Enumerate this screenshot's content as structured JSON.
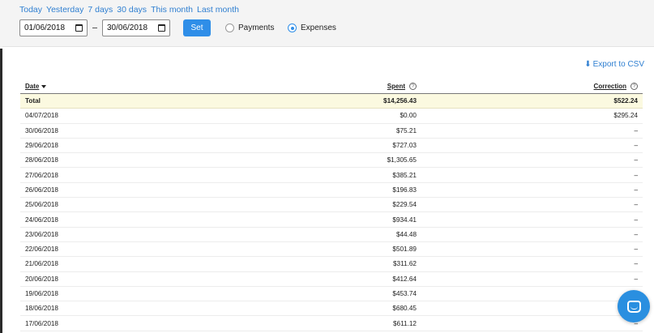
{
  "filters": {
    "quick_links": [
      "Today",
      "Yesterday",
      "7 days",
      "30 days",
      "This month",
      "Last month"
    ],
    "date_from": "01/06/2018",
    "date_to": "30/06/2018",
    "set_label": "Set",
    "radio_payments": "Payments",
    "radio_expenses": "Expenses",
    "selected": "Expenses"
  },
  "export_label": "Export to CSV",
  "table": {
    "columns": [
      "Date",
      "Spent",
      "Correction"
    ],
    "sort_column": "Date",
    "total": {
      "label": "Total",
      "spent": "$14,256.43",
      "correction": "$522.24"
    },
    "rows": [
      {
        "date": "04/07/2018",
        "spent": "$0.00",
        "correction": "$295.24"
      },
      {
        "date": "30/06/2018",
        "spent": "$75.21",
        "correction": "–"
      },
      {
        "date": "29/06/2018",
        "spent": "$727.03",
        "correction": "–"
      },
      {
        "date": "28/06/2018",
        "spent": "$1,305.65",
        "correction": "–"
      },
      {
        "date": "27/06/2018",
        "spent": "$385.21",
        "correction": "–"
      },
      {
        "date": "26/06/2018",
        "spent": "$196.83",
        "correction": "–"
      },
      {
        "date": "25/06/2018",
        "spent": "$229.54",
        "correction": "–"
      },
      {
        "date": "24/06/2018",
        "spent": "$934.41",
        "correction": "–"
      },
      {
        "date": "23/06/2018",
        "spent": "$44.48",
        "correction": "–"
      },
      {
        "date": "22/06/2018",
        "spent": "$501.89",
        "correction": "–"
      },
      {
        "date": "21/06/2018",
        "spent": "$311.62",
        "correction": "–"
      },
      {
        "date": "20/06/2018",
        "spent": "$412.64",
        "correction": "–"
      },
      {
        "date": "19/06/2018",
        "spent": "$453.74",
        "correction": "–"
      },
      {
        "date": "18/06/2018",
        "spent": "$680.45",
        "correction": "–"
      },
      {
        "date": "17/06/2018",
        "spent": "$611.12",
        "correction": "–"
      }
    ]
  },
  "colors": {
    "accent": "#2f8ee8",
    "link": "#2f7fd1",
    "total_row": "#fbf9e0"
  }
}
